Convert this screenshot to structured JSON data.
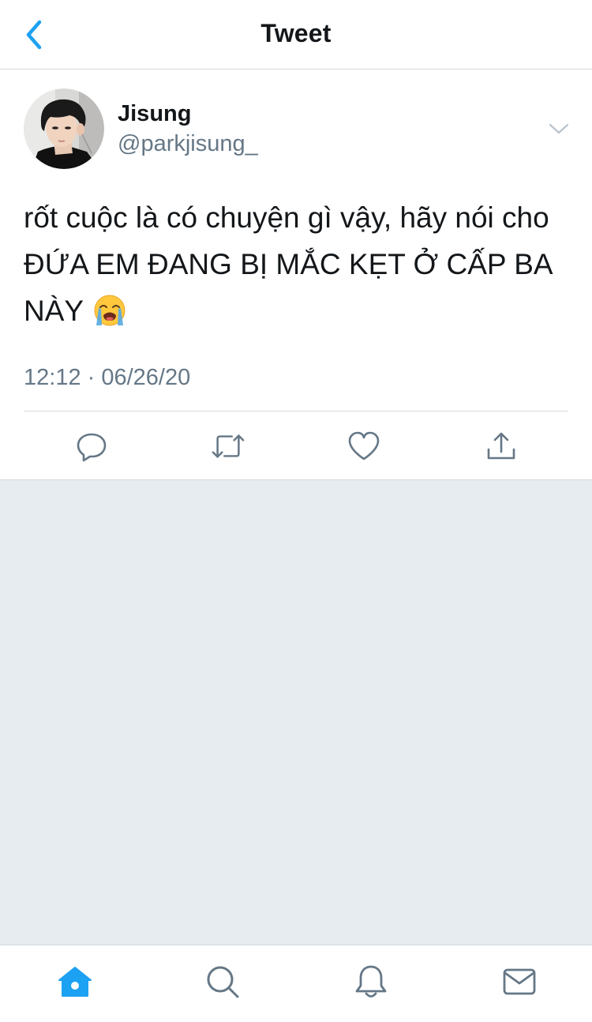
{
  "header": {
    "title": "Tweet",
    "back_icon": "chevron-left-icon"
  },
  "tweet": {
    "display_name": "Jisung",
    "handle": "@parkjisung_",
    "text": "rốt cuộc là có chuyện gì vậy, hãy nói cho ĐỨA EM ĐANG BỊ MẮC KẸT Ở CẤP BA NÀY",
    "emoji": "loudly-crying-face",
    "timestamp": "12:12 · 06/26/20",
    "actions": [
      "reply-icon",
      "retweet-icon",
      "like-icon",
      "share-icon"
    ]
  },
  "tabbar": {
    "tabs": [
      "home-icon",
      "search-icon",
      "notifications-icon",
      "messages-icon"
    ],
    "active": "home-icon"
  },
  "colors": {
    "accent": "#1da1f2",
    "text_primary": "#14171a",
    "text_secondary": "#657786",
    "icon_gray": "#657786",
    "background_empty": "#e6ecf0",
    "border": "#d5d9dd"
  }
}
